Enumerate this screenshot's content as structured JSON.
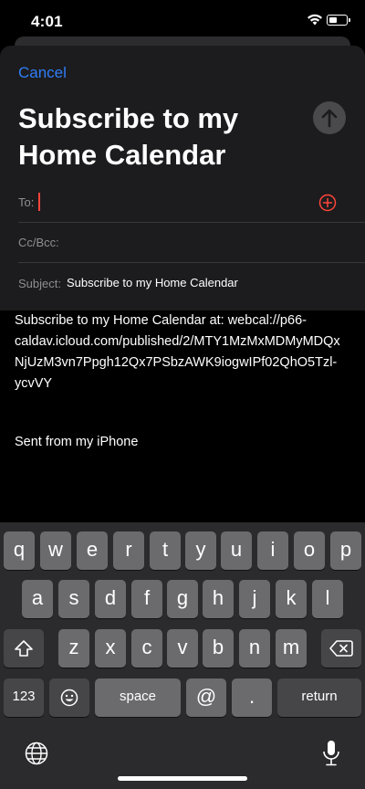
{
  "status": {
    "time": "4:01"
  },
  "compose": {
    "cancel_label": "Cancel",
    "title": "Subscribe to my Home Calendar",
    "to_label": "To:",
    "cc_label": "Cc/Bcc:",
    "subject_label": "Subject:",
    "subject_value": "Subscribe to my Home Calendar"
  },
  "body": {
    "line1": "Subscribe to my Home Calendar at: webcal://p66-",
    "line2": "caldav.icloud.com/published/2/MTY1MzMxMDMyMDQx",
    "line3": "NjUzM3vn7Ppgh12Qx7PSbzAWK9iogwIPf02QhO5Tzl-",
    "line4": "ycvVY",
    "signature": "Sent from my iPhone"
  },
  "keyboard": {
    "row1": [
      "q",
      "w",
      "e",
      "r",
      "t",
      "y",
      "u",
      "i",
      "o",
      "p"
    ],
    "row2": [
      "a",
      "s",
      "d",
      "f",
      "g",
      "h",
      "j",
      "k",
      "l"
    ],
    "row3": [
      "z",
      "x",
      "c",
      "v",
      "b",
      "n",
      "m"
    ],
    "numbers_label": "123",
    "space_label": "space",
    "at_label": "@",
    "dot_label": ".",
    "return_label": "return"
  },
  "icons": {
    "send": "arrow-up-icon",
    "add_recipient": "plus-circle-icon",
    "shift": "shift-icon",
    "delete": "backspace-icon",
    "emoji": "emoji-icon",
    "globe": "globe-icon",
    "dictation": "microphone-icon"
  },
  "colors": {
    "accent": "#2f7df6",
    "add_icon": "#ff453a"
  }
}
